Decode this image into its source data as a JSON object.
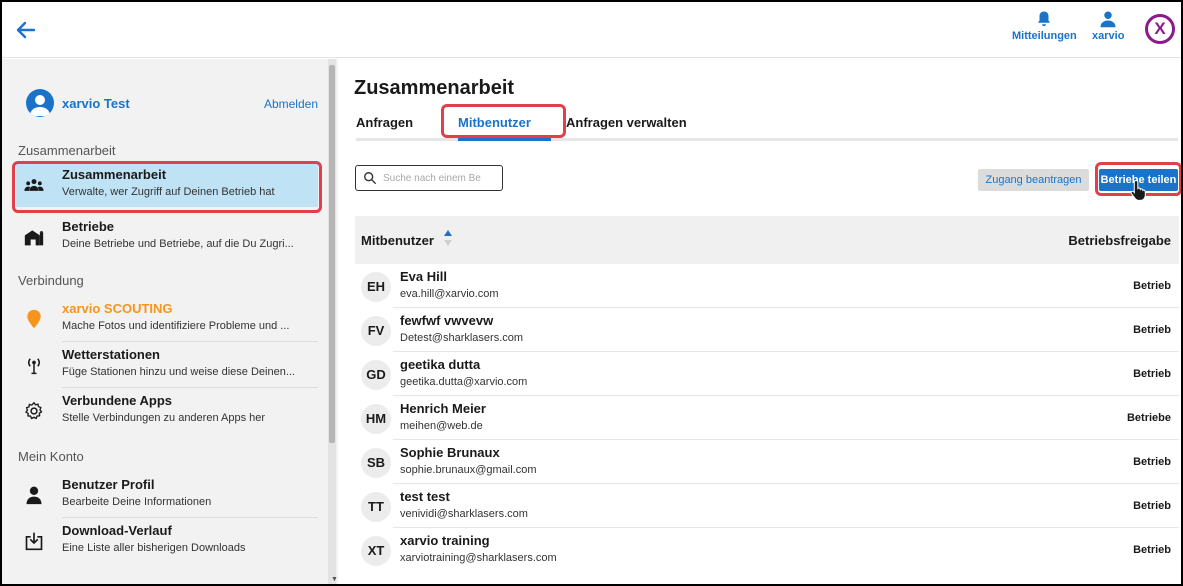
{
  "header": {
    "notifications_label": "Mitteilungen",
    "user_label": "xarvio",
    "logo_text": "X"
  },
  "sidebar": {
    "user_name": "xarvio Test",
    "logout_label": "Abmelden",
    "sections": [
      {
        "title": "Zusammenarbeit"
      },
      {
        "title": "Verbindung"
      },
      {
        "title": "Mein Konto"
      }
    ],
    "items": [
      {
        "title": "Zusammenarbeit",
        "subtitle": "Verwalte, wer Zugriff auf Deinen Betrieb hat",
        "icon": "group-icon"
      },
      {
        "title": "Betriebe",
        "subtitle": "Deine Betriebe und Betriebe, auf die Du Zugri...",
        "icon": "farm-icon"
      },
      {
        "title": "xarvio SCOUTING",
        "subtitle": "Mache Fotos und identifiziere Probleme und ...",
        "icon": "location-pin-icon",
        "title_color": "#f7941d"
      },
      {
        "title": "Wetterstationen",
        "subtitle": "Füge Stationen hinzu und weise diese Deinen...",
        "icon": "antenna-icon"
      },
      {
        "title": "Verbundene Apps",
        "subtitle": "Stelle Verbindungen zu anderen Apps her",
        "icon": "gear-icon"
      },
      {
        "title": "Benutzer Profil",
        "subtitle": "Bearbeite Deine Informationen",
        "icon": "person-icon"
      },
      {
        "title": "Download-Verlauf",
        "subtitle": "Eine Liste aller bisherigen Downloads",
        "icon": "download-icon"
      }
    ]
  },
  "main": {
    "title": "Zusammenarbeit",
    "tabs": [
      {
        "label": "Anfragen"
      },
      {
        "label": "Mitbenutzer",
        "active": true
      },
      {
        "label": "Anfragen verwalten"
      }
    ],
    "search_placeholder": "Suche nach einem Be",
    "request_access_label": "Zugang beantragen",
    "share_farms_label": "Betriebe teilen",
    "table": {
      "col_user": "Mitbenutzer",
      "col_share": "Betriebsfreigabe",
      "rows": [
        {
          "initials": "EH",
          "name": "Eva Hill",
          "email": "eva.hill@xarvio.com",
          "share": "Betrieb"
        },
        {
          "initials": "FV",
          "name": "fewfwf vwvevw",
          "email": "Detest@sharklasers.com",
          "share": "Betrieb"
        },
        {
          "initials": "GD",
          "name": "geetika dutta",
          "email": "geetika.dutta@xarvio.com",
          "share": "Betrieb"
        },
        {
          "initials": "HM",
          "name": "Henrich Meier",
          "email": "meihen@web.de",
          "share": "Betriebe"
        },
        {
          "initials": "SB",
          "name": "Sophie Brunaux",
          "email": "sophie.brunaux@gmail.com",
          "share": "Betrieb"
        },
        {
          "initials": "TT",
          "name": "test test",
          "email": "venividi@sharklasers.com",
          "share": "Betrieb"
        },
        {
          "initials": "XT",
          "name": "xarvio training",
          "email": "xarviotraining@sharklasers.com",
          "share": "Betrieb"
        }
      ]
    }
  },
  "colors": {
    "accent": "#1a73c8",
    "highlight": "#e0404a",
    "active_nav": "#bfe3f5",
    "brand": "#8b1a8b",
    "scouting": "#f7941d"
  }
}
